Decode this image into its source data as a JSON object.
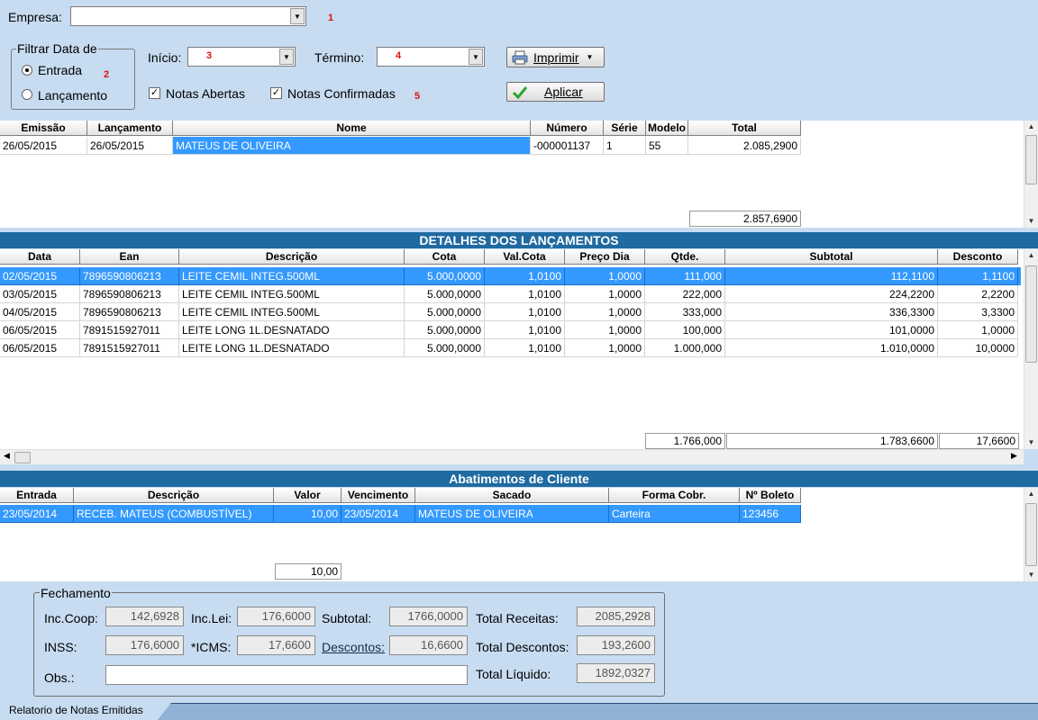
{
  "top": {
    "empresa_label": "Empresa:",
    "marker1": "1",
    "filtrar_label": "Filtrar Data de",
    "entrada_label": "Entrada",
    "lancamento_label": "Lançamento",
    "marker2": "2",
    "inicio_label": "Início:",
    "inicio_value": "3",
    "termino_label": "Término:",
    "termino_value": "4",
    "imprimir_label": "Imprimir",
    "aplicar_label": "Aplicar",
    "notas_abertas_label": "Notas Abertas",
    "notas_confirmadas_label": "Notas Confirmadas",
    "marker5": "5"
  },
  "notes": {
    "headers": [
      "Emissão",
      "Lançamento",
      "Nome",
      "Número",
      "Série",
      "Modelo",
      "Total"
    ],
    "rows": [
      [
        "26/05/2015",
        "26/05/2015",
        "MATEUS DE OLIVEIRA",
        "-000001137",
        "1",
        "55",
        "2.085,2900"
      ]
    ],
    "total": "2.857,6900"
  },
  "details": {
    "title": "DETALHES DOS LANÇAMENTOS",
    "headers": [
      "Data",
      "Ean",
      "Descrição",
      "Cota",
      "Val.Cota",
      "Preço Dia",
      "Qtde.",
      "Subtotal",
      "Desconto"
    ],
    "rows": [
      [
        "02/05/2015",
        "7896590806213",
        "LEITE CEMIL INTEG.500ML",
        "5.000,0000",
        "1,0100",
        "1,0000",
        "111,000",
        "112,1100",
        "1,1100"
      ],
      [
        "03/05/2015",
        "7896590806213",
        "LEITE CEMIL INTEG.500ML",
        "5.000,0000",
        "1,0100",
        "1,0000",
        "222,000",
        "224,2200",
        "2,2200"
      ],
      [
        "04/05/2015",
        "7896590806213",
        "LEITE CEMIL INTEG.500ML",
        "5.000,0000",
        "1,0100",
        "1,0000",
        "333,000",
        "336,3300",
        "3,3300"
      ],
      [
        "06/05/2015",
        "7891515927011",
        "LEITE LONG 1L.DESNATADO",
        "5.000,0000",
        "1,0100",
        "1,0000",
        "100,000",
        "101,0000",
        "1,0000"
      ],
      [
        "06/05/2015",
        "7891515927011",
        "LEITE LONG 1L.DESNATADO",
        "5.000,0000",
        "1,0100",
        "1,0000",
        "1.000,000",
        "1.010,0000",
        "10,0000"
      ]
    ],
    "totals": {
      "qtde": "1.766,000",
      "subtotal": "1.783,6600",
      "desconto": "17,6600"
    }
  },
  "abatimentos": {
    "title": "Abatimentos de Cliente",
    "headers": [
      "Entrada",
      "Descrição",
      "Valor",
      "Vencimento",
      "Sacado",
      "Forma Cobr.",
      "Nº Boleto"
    ],
    "rows": [
      [
        "23/05/2014",
        "RECEB. MATEUS (COMBUSTÍVEL)",
        "10,00",
        "23/05/2014",
        "MATEUS DE OLIVEIRA",
        "Carteira",
        "123456"
      ]
    ],
    "total": "10,00"
  },
  "fechamento": {
    "title": "Fechamento",
    "inc_coop_label": "Inc.Coop:",
    "inc_coop": "142,6928",
    "inc_lei_label": "Inc.Lei:",
    "inc_lei": "176,6000",
    "subtotal_label": "Subtotal:",
    "subtotal": "1766,0000",
    "total_receitas_label": "Total Receitas:",
    "total_receitas": "2085,2928",
    "inss_label": "INSS:",
    "inss": "176,6000",
    "icms_label": "*ICMS:",
    "icms": "17,6600",
    "descontos_label": "Descontos:",
    "descontos": "16,6600",
    "total_descontos_label": "Total Descontos:",
    "total_descontos": "193,2600",
    "obs_label": "Obs.:",
    "obs": "",
    "total_liquido_label": "Total Líquido:",
    "total_liquido": "1892,0327"
  },
  "tab": {
    "label": "Relatorio de Notas Emitidas"
  },
  "colors": {
    "selection": "#3399ff",
    "section_header": "#1f6aa0",
    "background": "#c7dcf1",
    "marker": "#e01010"
  }
}
